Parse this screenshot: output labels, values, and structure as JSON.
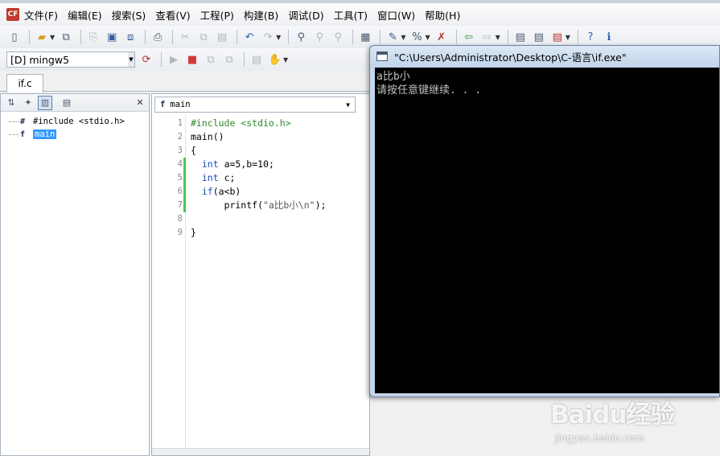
{
  "app": {
    "logo_text": "CF",
    "menu": [
      "文件(F)",
      "编辑(E)",
      "搜索(S)",
      "查看(V)",
      "工程(P)",
      "构建(B)",
      "调试(D)",
      "工具(T)",
      "窗口(W)",
      "帮助(H)"
    ]
  },
  "toolbar": {
    "compiler_selected": "[D] mingw5"
  },
  "tabs": {
    "file_tab": "if.c"
  },
  "outline": {
    "items": [
      {
        "icon": "#",
        "label": "#include <stdio.h>"
      },
      {
        "icon": "f",
        "label": "main"
      }
    ]
  },
  "editor": {
    "function_select": "main",
    "function_icon": "f",
    "lines": [
      {
        "n": "1",
        "text": "#include <stdio.h>"
      },
      {
        "n": "2",
        "text": "main()"
      },
      {
        "n": "3",
        "text": "{"
      },
      {
        "n": "4",
        "text": "  int a=5,b=10;"
      },
      {
        "n": "5",
        "text": "  int c;"
      },
      {
        "n": "6",
        "text": "  if(a<b)"
      },
      {
        "n": "7",
        "text": "      printf(\"a比b小\\n\");"
      },
      {
        "n": "8",
        "text": ""
      },
      {
        "n": "9",
        "text": "}"
      }
    ]
  },
  "console": {
    "title": "\"C:\\Users\\Administrator\\Desktop\\C-语言\\if.exe\"",
    "lines": [
      "a比b小",
      "请按任意键继续. . ."
    ]
  },
  "watermark": {
    "brand": "Baidu经验",
    "site": "jingyan.baidu.com"
  },
  "colors": {
    "keyword": "#1b4dbb",
    "preprocessor": "#2b8a2b",
    "selection": "#3399ff",
    "change_marker": "#47c65a",
    "console_bg": "#000000"
  }
}
